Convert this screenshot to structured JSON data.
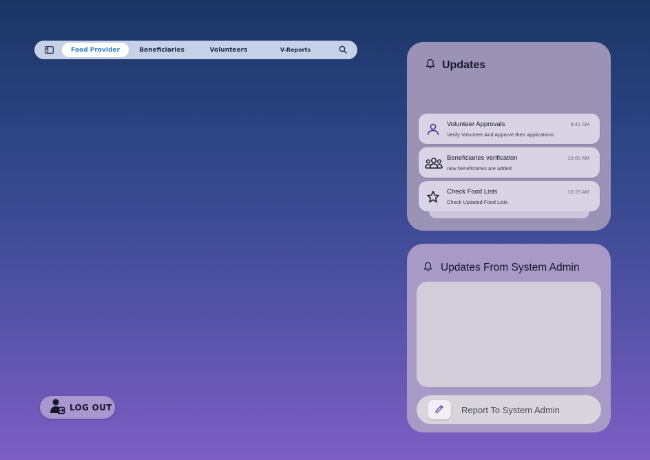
{
  "nav": {
    "tabs": [
      {
        "label": "Food Provider",
        "active": true
      },
      {
        "label": "Beneficiaries",
        "active": false
      },
      {
        "label": "Volunteers",
        "active": false
      },
      {
        "label": "V-Reports",
        "active": false
      }
    ],
    "sidebar_icon": "sidebar-toggle-icon",
    "search_icon": "search-icon"
  },
  "logout": {
    "label": "LOG OUT",
    "icon": "user-logout-icon"
  },
  "updates": {
    "title": "Updates",
    "icon": "bell-icon",
    "items": [
      {
        "title": "Volunteer Approvals",
        "subtitle": "Verify Volunteer And Approve their applications",
        "time": "9:41 AM",
        "icon": "person-icon"
      },
      {
        "title": "Beneficiaries verification",
        "subtitle": "new beneficiaries are added",
        "time": "10:00 AM",
        "icon": "group-icon"
      },
      {
        "title": "Check Food Lists",
        "subtitle": "Check Updated Food Lists",
        "time": "10:15 AM",
        "icon": "star-icon"
      }
    ]
  },
  "admin": {
    "title": "Updates From System Admin",
    "icon": "bell-icon",
    "report_label": "Report To  System Admin",
    "report_icon": "pencil-icon"
  },
  "colors": {
    "accent": "#2a7ec9",
    "panel": "#9b93b5",
    "admin_panel": "#a89ac7"
  }
}
